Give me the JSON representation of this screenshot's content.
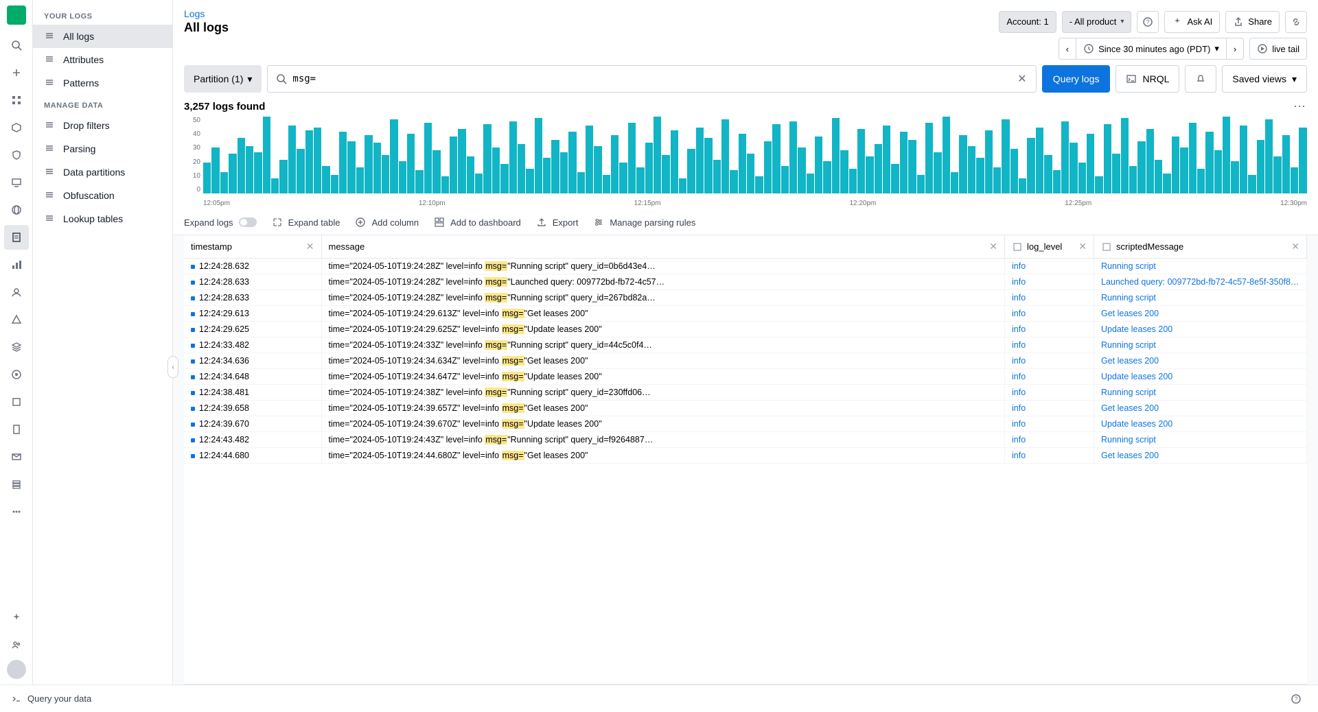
{
  "header": {
    "breadcrumb": "Logs",
    "title": "All logs",
    "account_label": "Account: 1",
    "product_label": "- All product",
    "ask_ai": "Ask AI",
    "share": "Share"
  },
  "sidebar": {
    "section1": "YOUR LOGS",
    "items1": [
      {
        "label": "All logs",
        "active": true
      },
      {
        "label": "Attributes"
      },
      {
        "label": "Patterns"
      }
    ],
    "section2": "MANAGE DATA",
    "items2": [
      {
        "label": "Drop filters"
      },
      {
        "label": "Parsing"
      },
      {
        "label": "Data partitions"
      },
      {
        "label": "Obfuscation"
      },
      {
        "label": "Lookup tables"
      }
    ]
  },
  "controls": {
    "partition": "Partition (1)",
    "search_value": "msg=",
    "query_logs": "Query logs",
    "nrql": "NRQL",
    "saved_views": "Saved views",
    "timerange": "Since 30 minutes ago (PDT)",
    "live_tail": "live tail"
  },
  "stats": {
    "found": "3,257 logs found"
  },
  "chart_data": {
    "type": "bar",
    "title": "",
    "xlabel": "",
    "ylabel": "",
    "ylim": [
      0,
      50
    ],
    "y_ticks": [
      "50",
      "40",
      "30",
      "20",
      "10",
      "0"
    ],
    "x_ticks": [
      "12:05pm",
      "12:10pm",
      "12:15pm",
      "12:20pm",
      "12:25pm",
      "12:30pm"
    ],
    "values": [
      20,
      30,
      14,
      26,
      36,
      31,
      27,
      50,
      10,
      22,
      44,
      29,
      41,
      43,
      18,
      12,
      40,
      34,
      17,
      38,
      33,
      25,
      48,
      21,
      39,
      15,
      46,
      28,
      11,
      37,
      42,
      24,
      13,
      45,
      30,
      19,
      47,
      32,
      16,
      49,
      23,
      35,
      27,
      40,
      14,
      44,
      31,
      12,
      38,
      20,
      46,
      17,
      33,
      50,
      25,
      41,
      10,
      29,
      43,
      36,
      22,
      48,
      15,
      39,
      26,
      11,
      34,
      45,
      18,
      47,
      30,
      13,
      37,
      21,
      49,
      28,
      16,
      42,
      24,
      32,
      44,
      19,
      40,
      35,
      12,
      46,
      27,
      50,
      14,
      38,
      31,
      23,
      41,
      17,
      48,
      29,
      10,
      36,
      43,
      25,
      15,
      47,
      33,
      20,
      39,
      11,
      45,
      26,
      49,
      18,
      34,
      42,
      22,
      13,
      37,
      30,
      46,
      16,
      40,
      28,
      50,
      21,
      44,
      12,
      35,
      48,
      24,
      38,
      17,
      43
    ]
  },
  "toolbar": {
    "expand_logs": "Expand logs",
    "expand_table": "Expand table",
    "add_column": "Add column",
    "add_dashboard": "Add to dashboard",
    "export": "Export",
    "manage_rules": "Manage parsing rules"
  },
  "table": {
    "columns": [
      "timestamp",
      "message",
      "log_level",
      "scriptedMessage"
    ],
    "rows": [
      {
        "ts": "12:24:28.632",
        "pre": "time=\"2024-05-10T19:24:28Z\" level=info ",
        "post": "\"Running script\" query_id=0b6d43e4…",
        "lvl": "info",
        "sm": "Running script"
      },
      {
        "ts": "12:24:28.633",
        "pre": "time=\"2024-05-10T19:24:28Z\" level=info ",
        "post": "\"Launched query: 009772bd-fb72-4c57…",
        "lvl": "info",
        "sm": "Launched query: 009772bd-fb72-4c57-8e5f-350f8…"
      },
      {
        "ts": "12:24:28.633",
        "pre": "time=\"2024-05-10T19:24:28Z\" level=info ",
        "post": "\"Running script\" query_id=267bd82a…",
        "lvl": "info",
        "sm": "Running script"
      },
      {
        "ts": "12:24:29.613",
        "pre": "time=\"2024-05-10T19:24:29.613Z\" level=info ",
        "post": "\"Get leases 200\"",
        "lvl": "info",
        "sm": "Get leases 200"
      },
      {
        "ts": "12:24:29.625",
        "pre": "time=\"2024-05-10T19:24:29.625Z\" level=info ",
        "post": "\"Update leases 200\"",
        "lvl": "info",
        "sm": "Update leases 200"
      },
      {
        "ts": "12:24:33.482",
        "pre": "time=\"2024-05-10T19:24:33Z\" level=info ",
        "post": "\"Running script\" query_id=44c5c0f4…",
        "lvl": "info",
        "sm": "Running script"
      },
      {
        "ts": "12:24:34.636",
        "pre": "time=\"2024-05-10T19:24:34.634Z\" level=info ",
        "post": "\"Get leases 200\"",
        "lvl": "info",
        "sm": "Get leases 200"
      },
      {
        "ts": "12:24:34.648",
        "pre": "time=\"2024-05-10T19:24:34.647Z\" level=info ",
        "post": "\"Update leases 200\"",
        "lvl": "info",
        "sm": "Update leases 200"
      },
      {
        "ts": "12:24:38.481",
        "pre": "time=\"2024-05-10T19:24:38Z\" level=info ",
        "post": "\"Running script\" query_id=230ffd06…",
        "lvl": "info",
        "sm": "Running script"
      },
      {
        "ts": "12:24:39.658",
        "pre": "time=\"2024-05-10T19:24:39.657Z\" level=info ",
        "post": "\"Get leases 200\"",
        "lvl": "info",
        "sm": "Get leases 200"
      },
      {
        "ts": "12:24:39.670",
        "pre": "time=\"2024-05-10T19:24:39.670Z\" level=info ",
        "post": "\"Update leases 200\"",
        "lvl": "info",
        "sm": "Update leases 200"
      },
      {
        "ts": "12:24:43.482",
        "pre": "time=\"2024-05-10T19:24:43Z\" level=info ",
        "post": "\"Running script\" query_id=f9264887…",
        "lvl": "info",
        "sm": "Running script"
      },
      {
        "ts": "12:24:44.680",
        "pre": "time=\"2024-05-10T19:24:44.680Z\" level=info ",
        "post": "\"Get leases 200\"",
        "lvl": "info",
        "sm": "Get leases 200"
      }
    ]
  },
  "footer": {
    "query": "Query your data"
  },
  "colors": {
    "accent": "#0D74DF",
    "bar": "#11b5c5",
    "highlight": "#fde68a"
  }
}
